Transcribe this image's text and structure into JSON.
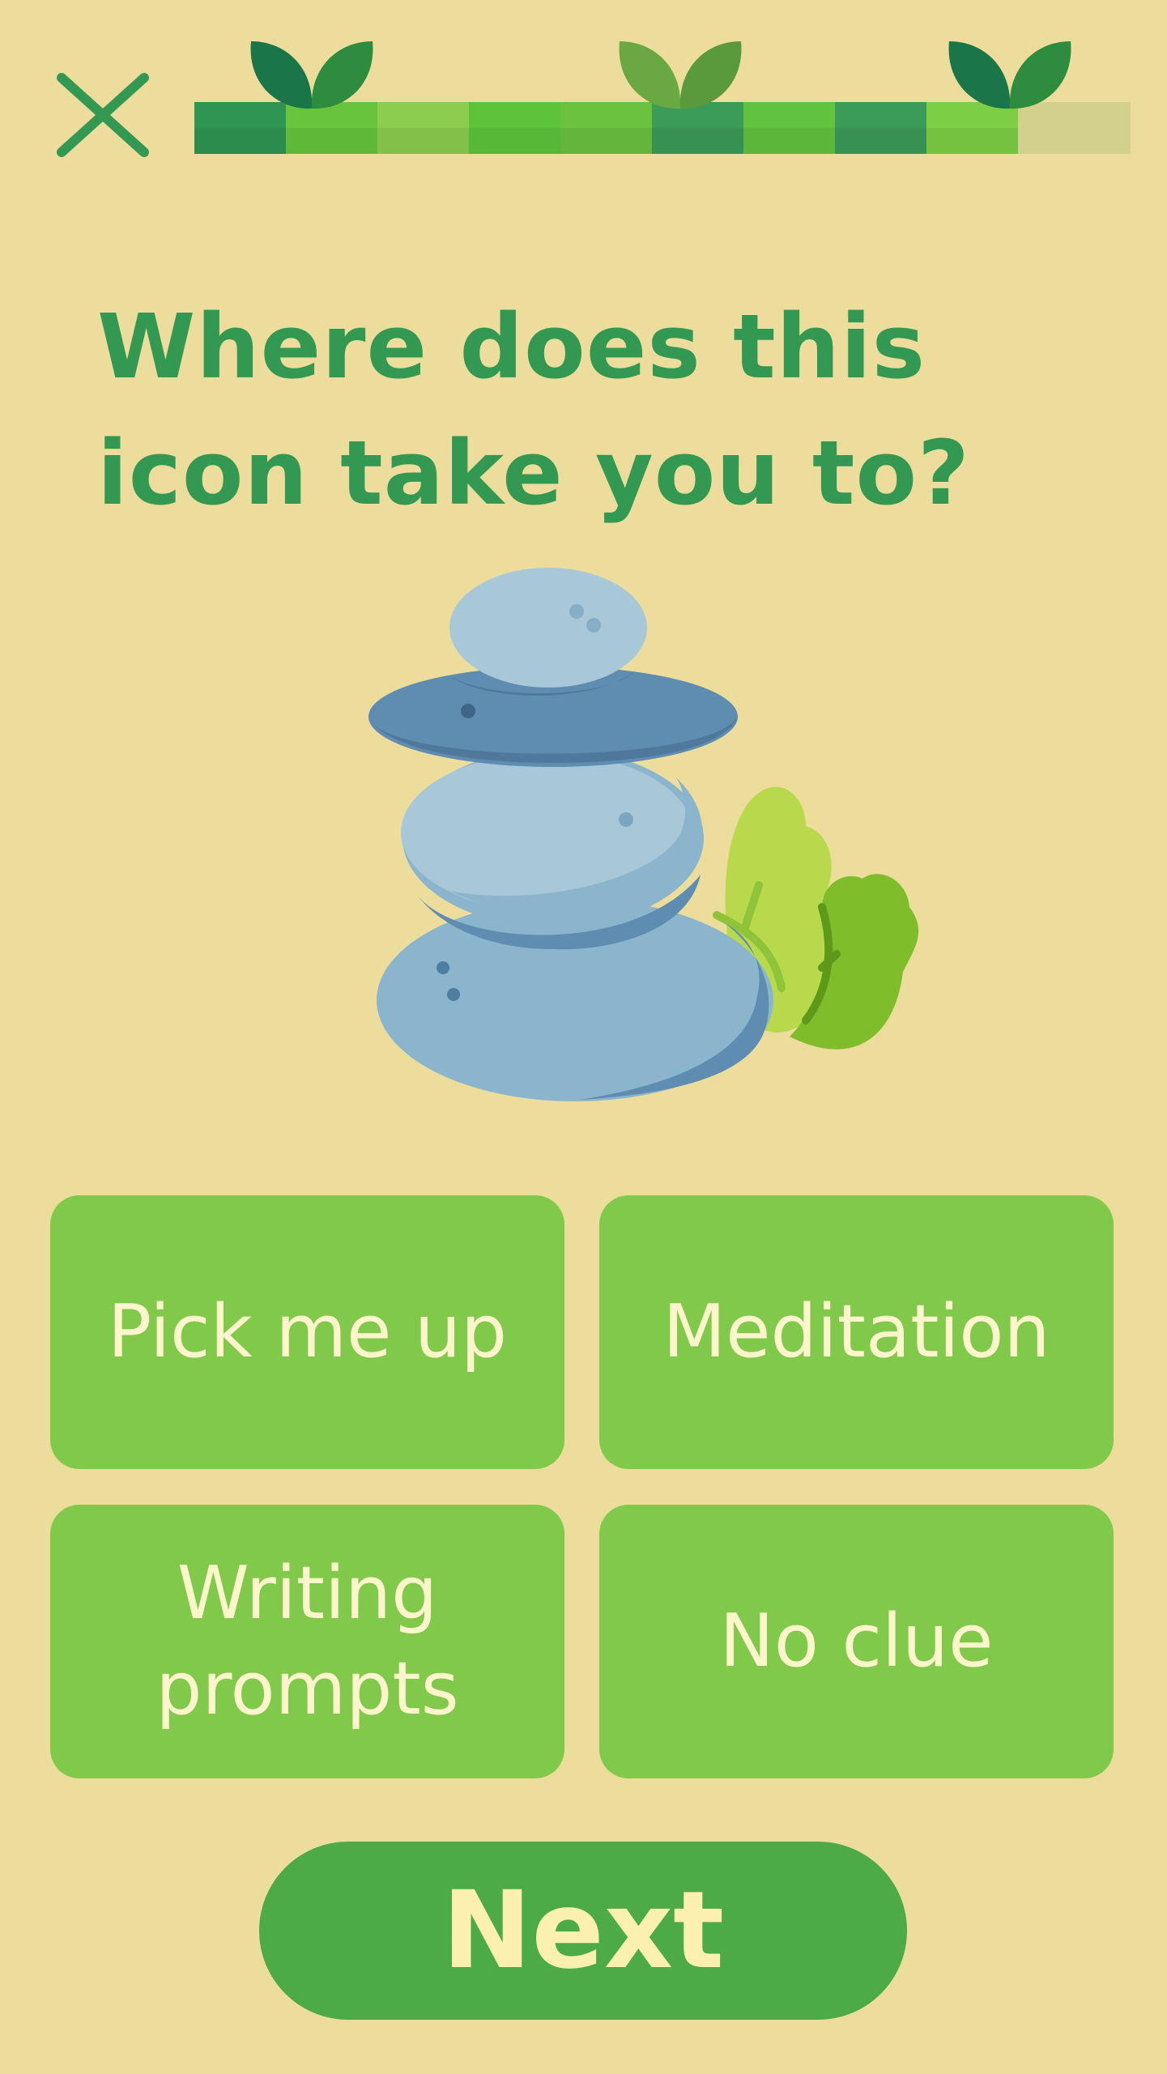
{
  "question": {
    "text": "Where does this icon take you to?"
  },
  "progress": {
    "fraction": 0.88,
    "segment_colors": [
      "#2e9553",
      "#67c43c",
      "#8ccc4f",
      "#5cc43a",
      "#6ac23f",
      "#3b9b58",
      "#61c23d",
      "#3b9b58",
      "#7ccf44"
    ]
  },
  "answers": [
    {
      "label": "Pick me up"
    },
    {
      "label": "Meditation"
    },
    {
      "label": "Writing prompts"
    },
    {
      "label": "No clue"
    }
  ],
  "next_button": {
    "label": "Next"
  },
  "icons": {
    "close": "close-icon",
    "progress_marker": "sprout-icon",
    "illustration": "stacked-stones-with-leaves-icon"
  },
  "colors": {
    "background": "#ecdd9c",
    "primary_green": "#339852",
    "answer_bg": "#80c94a",
    "answer_text": "#fdf5cc",
    "next_bg": "#4cab46",
    "next_text": "#fbf0b0"
  }
}
